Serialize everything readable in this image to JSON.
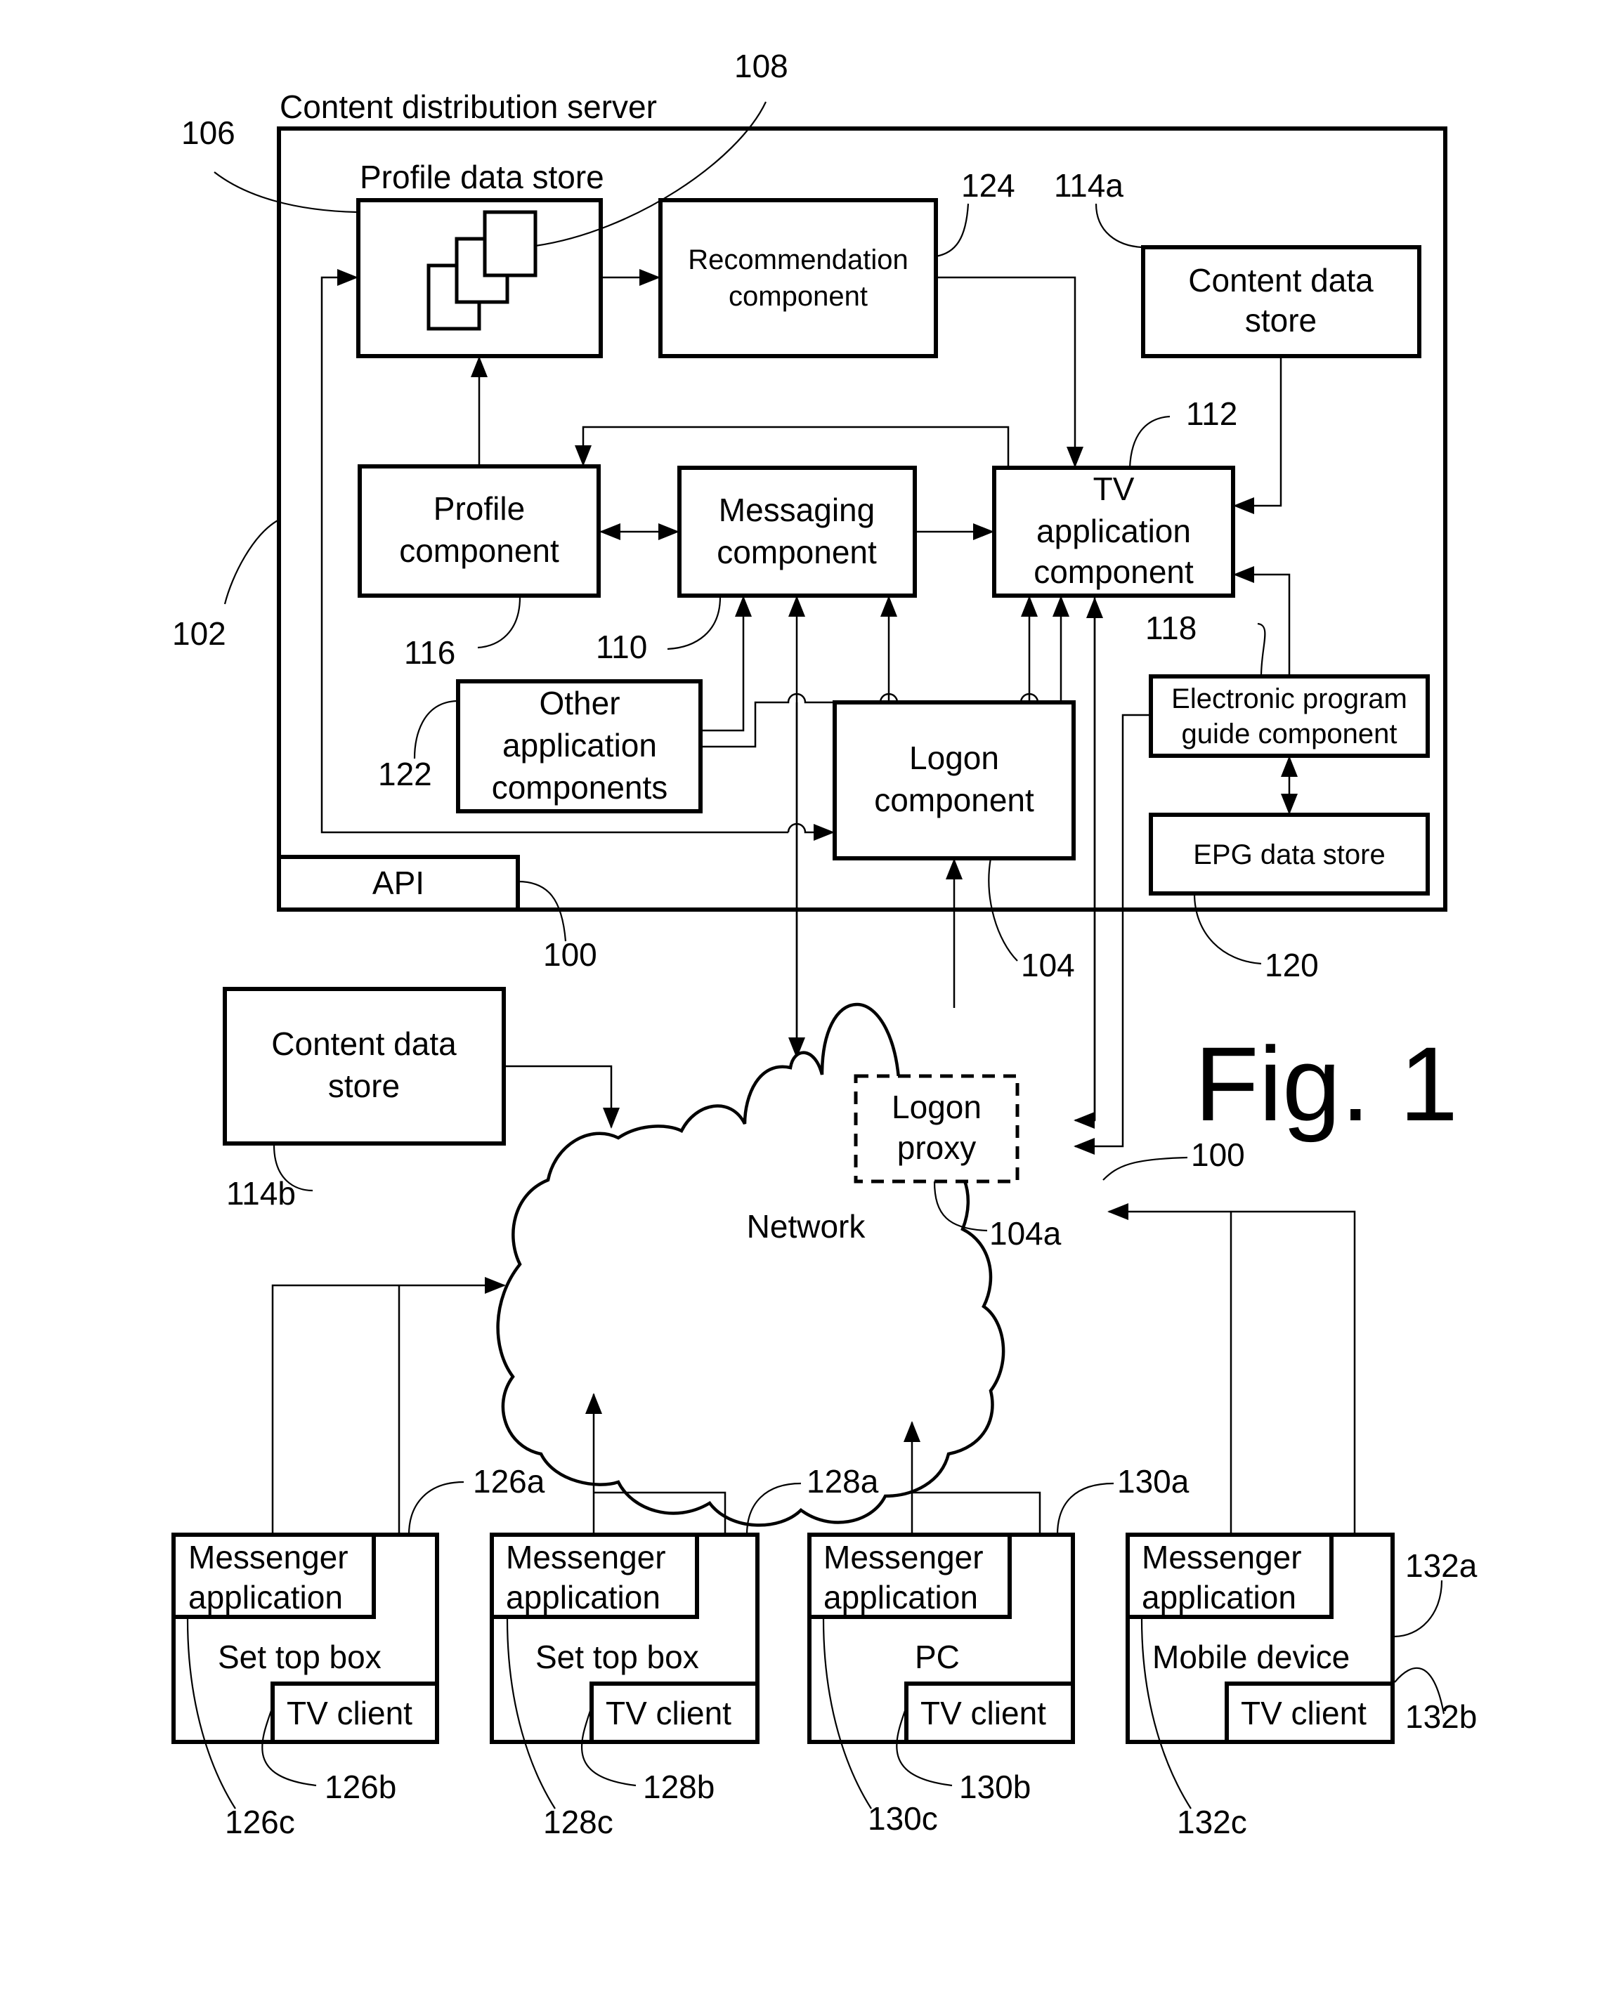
{
  "figure": {
    "title": "Fig. 1",
    "server_title": "Content distribution server"
  },
  "components": {
    "profile_data_store": "Profile data store",
    "recommendation": [
      "Recommendation",
      "component"
    ],
    "content_data_store_a": [
      "Content data",
      "store"
    ],
    "profile_component": [
      "Profile",
      "component"
    ],
    "messaging_component": [
      "Messaging",
      "component"
    ],
    "tv_application_component": [
      "TV",
      "application",
      "component"
    ],
    "other_application_components": [
      "Other",
      "application",
      "components"
    ],
    "logon_component": [
      "Logon",
      "component"
    ],
    "epg_component": [
      "Electronic program",
      "guide component"
    ],
    "epg_data_store": "EPG data store",
    "api": "API",
    "content_data_store_b": [
      "Content data",
      "store"
    ],
    "network": "Network",
    "logon_proxy": [
      "Logon",
      "proxy"
    ]
  },
  "devices": [
    {
      "app": [
        "Messenger",
        "application"
      ],
      "device": "Set top box",
      "client": "TV client",
      "ref_a": "126a",
      "ref_b": "126b",
      "ref_c": "126c"
    },
    {
      "app": [
        "Messenger",
        "application"
      ],
      "device": "Set top box",
      "client": "TV client",
      "ref_a": "128a",
      "ref_b": "128b",
      "ref_c": "128c"
    },
    {
      "app": [
        "Messenger",
        "application"
      ],
      "device": "PC",
      "client": "TV client",
      "ref_a": "130a",
      "ref_b": "130b",
      "ref_c": "130c"
    },
    {
      "app": [
        "Messenger",
        "application"
      ],
      "device": "Mobile device",
      "client": "TV client",
      "ref_a": "132a",
      "ref_b": "132b",
      "ref_c": "132c"
    }
  ],
  "refs": {
    "r100_api": "100",
    "r100_net": "100",
    "r102": "102",
    "r104": "104",
    "r104a": "104a",
    "r106": "106",
    "r108": "108",
    "r110": "110",
    "r112": "112",
    "r114a": "114a",
    "r114b": "114b",
    "r116": "116",
    "r118": "118",
    "r120": "120",
    "r122": "122",
    "r124": "124"
  }
}
